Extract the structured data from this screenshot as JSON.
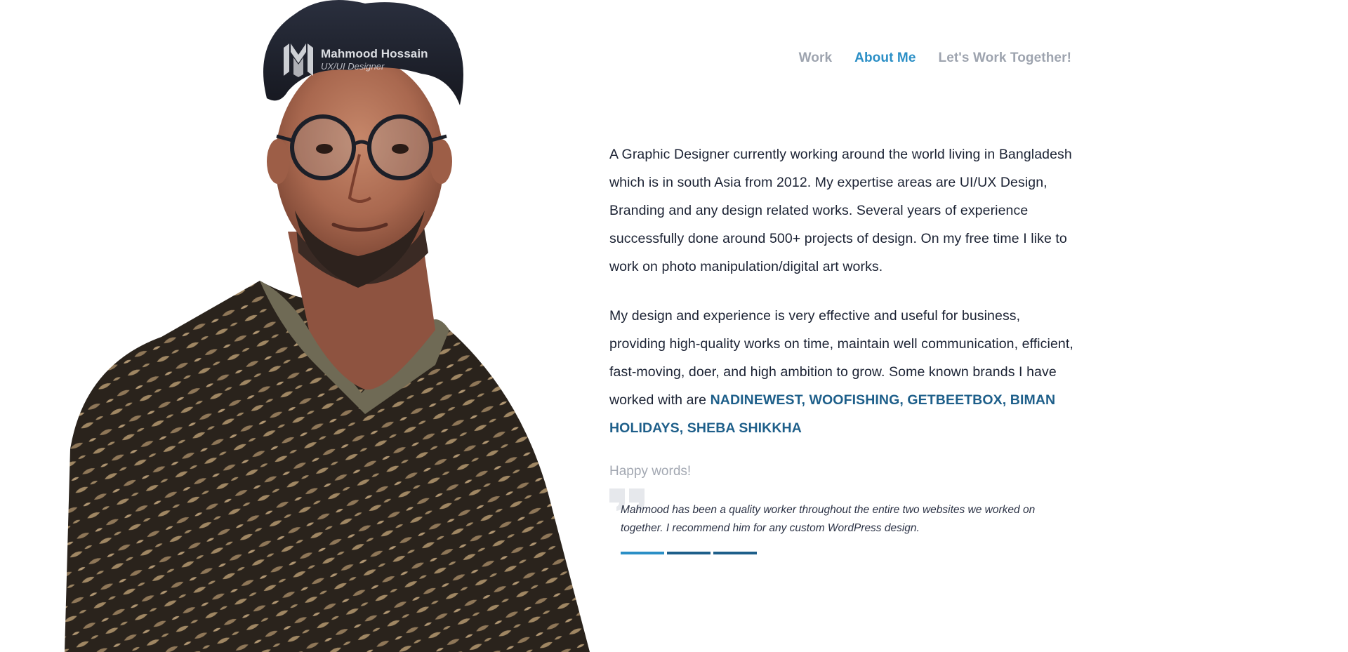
{
  "logo": {
    "name": "Mahmood Hossain",
    "role": "UX/UI Designer"
  },
  "nav": {
    "items": [
      {
        "label": "Work",
        "active": false
      },
      {
        "label": "About Me",
        "active": true
      },
      {
        "label": "Let's Work Together!",
        "active": false
      }
    ]
  },
  "about": {
    "paragraph1": "A Graphic Designer currently working around the world living in Bangladesh which is in south Asia from 2012. My expertise areas are UI/UX Design, Branding and any design related works. Several years of experience successfully done around 500+ projects of design. On my free time I like to work on photo manipulation/digital art works.",
    "paragraph2_intro": "My design and experience is very effective and useful for business, providing high-quality works on time, maintain well communication, efficient, fast-moving, doer, and high ambition to grow. Some known brands I have worked with are ",
    "brands": "NADINEWEST, WOOFISHING, GETBEETBOX, BIMAN HOLIDAYS, SHEBA SHIKKHA"
  },
  "testimonials": {
    "heading": "Happy words!",
    "quote": "Mahmood has been a quality worker throughout the entire two websites we worked on together. I recommend him for any custom WordPress design.",
    "slide_count": 3,
    "active_slide": 1
  },
  "colors": {
    "accent": "#2b8fc6",
    "brand_text": "#1e5f8a",
    "nav_inactive": "#9ea4af",
    "body_text": "#1b2233"
  }
}
